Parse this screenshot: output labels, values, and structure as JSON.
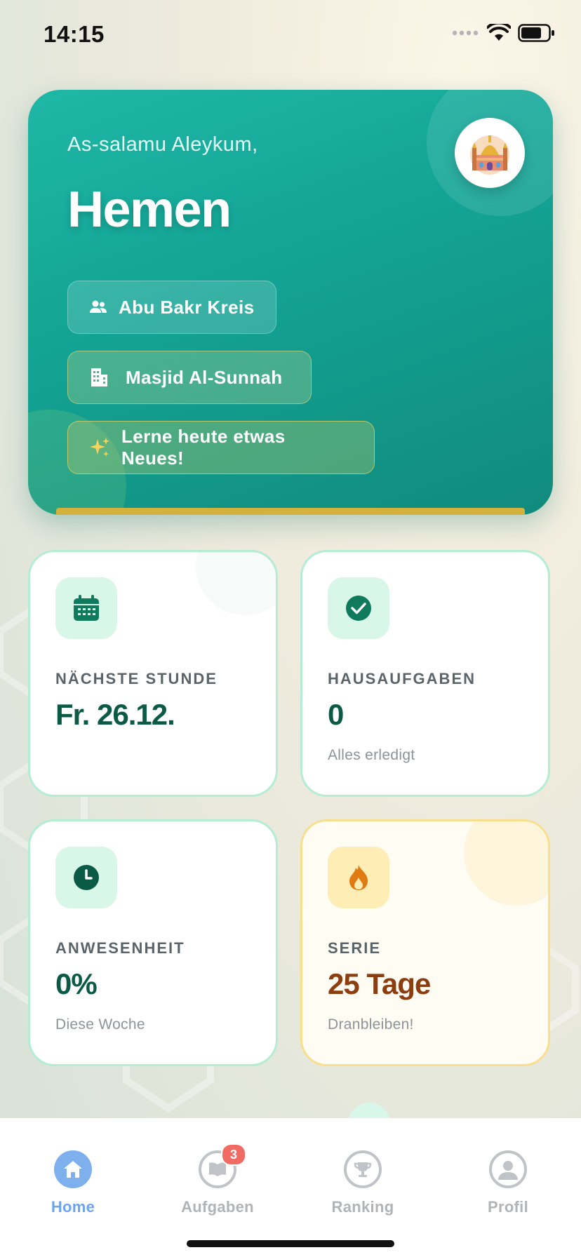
{
  "status_bar": {
    "time": "14:15"
  },
  "hero": {
    "greeting": "As-salamu Aleykum,",
    "name": "Hemen",
    "chips": [
      {
        "label": "Abu Bakr Kreis",
        "icon": "group-icon"
      },
      {
        "label": "Masjid Al-Sunnah",
        "icon": "building-icon"
      },
      {
        "label": "Lerne heute etwas Neues!",
        "icon": "sparkles-icon"
      }
    ],
    "avatar_icon": "mosque-icon"
  },
  "cards": [
    {
      "label": "NÄCHSTE STUNDE",
      "value": "Fr. 26.12.",
      "sub": "",
      "icon": "calendar-icon"
    },
    {
      "label": "HAUSAUFGABEN",
      "value": "0",
      "sub": "Alles erledigt",
      "icon": "check-circle-icon"
    },
    {
      "label": "ANWESENHEIT",
      "value": "0%",
      "sub": "Diese Woche",
      "icon": "clock-icon"
    },
    {
      "label": "SERIE",
      "value": "25 Tage",
      "sub": "Dranbleiben!",
      "icon": "flame-icon"
    }
  ],
  "tabbar": {
    "tabs": [
      {
        "label": "Home",
        "icon": "home-icon",
        "active": true
      },
      {
        "label": "Aufgaben",
        "icon": "book-icon",
        "badge": "3"
      },
      {
        "label": "Ranking",
        "icon": "trophy-icon"
      },
      {
        "label": "Profil",
        "icon": "user-icon"
      }
    ]
  },
  "colors": {
    "hero_teal": "#13a596",
    "card_value_green": "#0b5a45",
    "serie_brown": "#8c3e10",
    "active_tab": "#6fa4ec",
    "badge_red": "#ef6b63"
  }
}
